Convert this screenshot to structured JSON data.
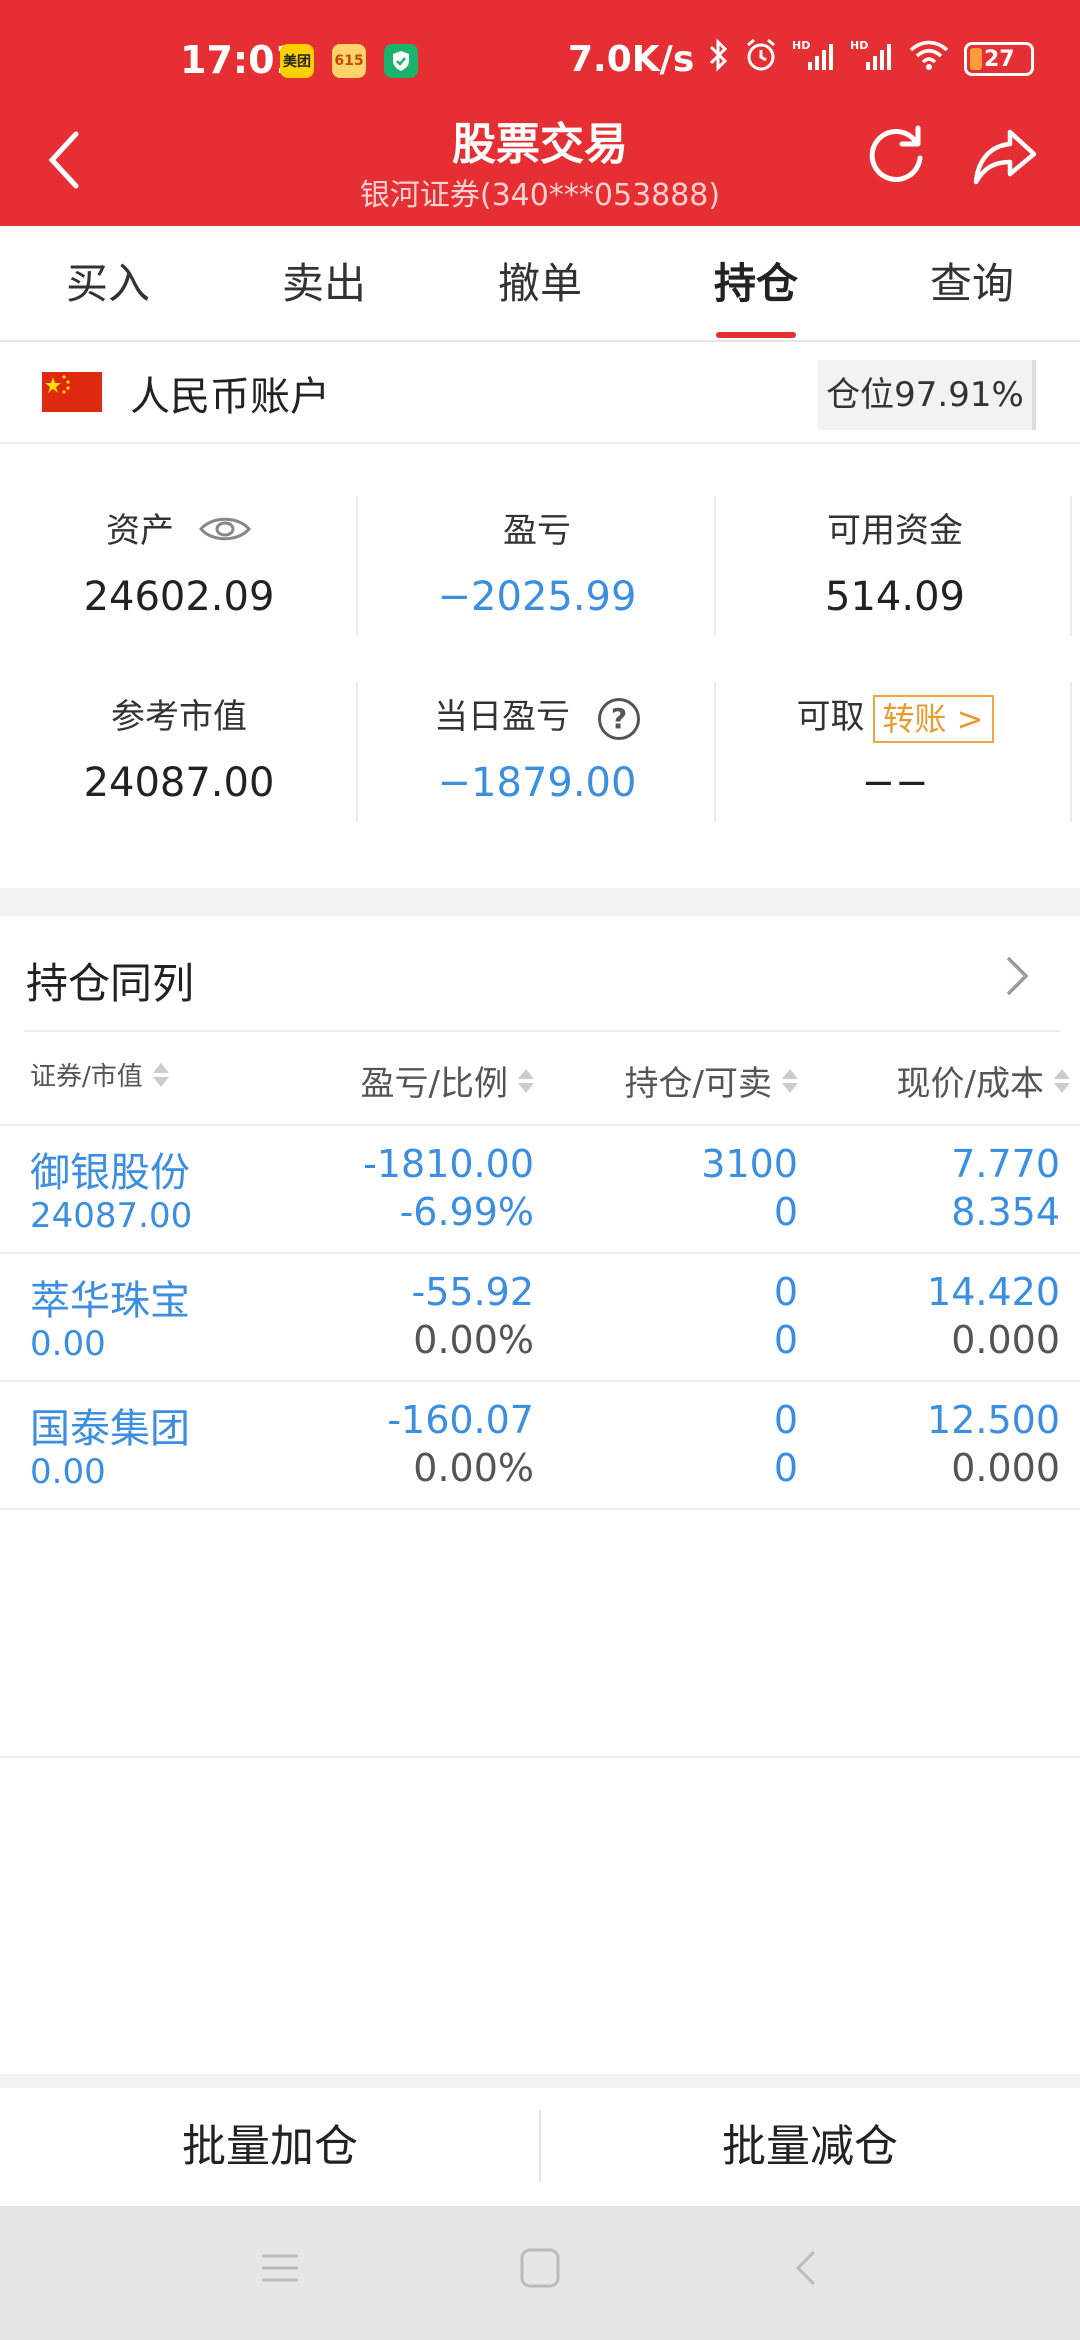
{
  "status_bar": {
    "time": "17:01",
    "apps": [
      "美团",
      "615",
      "shield"
    ],
    "net_speed": "7.0K/s",
    "battery": "27",
    "icons": [
      "bluetooth-icon",
      "alarm-icon",
      "signal-hd-icon",
      "signal-hd-icon",
      "wifi-icon"
    ]
  },
  "header": {
    "title": "股票交易",
    "subtitle": "银河证券(340***053888)",
    "bg_color": "#e62f33"
  },
  "tabs": [
    {
      "label": "买入"
    },
    {
      "label": "卖出"
    },
    {
      "label": "撤单"
    },
    {
      "label": "持仓",
      "active": true
    },
    {
      "label": "查询"
    }
  ],
  "account": {
    "name": "人民币账户",
    "position_ratio": "仓位97.91%"
  },
  "summary": {
    "assets_label": "资产",
    "assets_value": "24602.09",
    "pnl_label": "盈亏",
    "pnl_value": "−2025.99",
    "available_label": "可用资金",
    "available_value": "514.09",
    "market_value_label": "参考市值",
    "market_value_value": "24087.00",
    "daily_pnl_label": "当日盈亏",
    "daily_pnl_value": "−1879.00",
    "withdrawable_label": "可取",
    "transfer_label": "转账 >",
    "withdrawable_value": "−−"
  },
  "holdings": {
    "title": "持仓同列",
    "columns": [
      "证券/市值",
      "盈亏/比例",
      "持仓/可卖",
      "现价/成本"
    ],
    "rows": [
      {
        "name": "御银股份",
        "market_value": "24087.00",
        "pnl": "-1810.00",
        "ratio": "-6.99%",
        "holding": "3100",
        "sellable": "0",
        "price": "7.770",
        "cost": "8.354"
      },
      {
        "name": "萃华珠宝",
        "market_value": "0.00",
        "pnl": "-55.92",
        "ratio": "0.00%",
        "holding": "0",
        "sellable": "0",
        "price": "14.420",
        "cost": "0.000"
      },
      {
        "name": "国泰集团",
        "market_value": "0.00",
        "pnl": "-160.07",
        "ratio": "0.00%",
        "holding": "0",
        "sellable": "0",
        "price": "12.500",
        "cost": "0.000"
      }
    ]
  },
  "actions": {
    "batch_add": "批量加仓",
    "batch_reduce": "批量减仓"
  }
}
